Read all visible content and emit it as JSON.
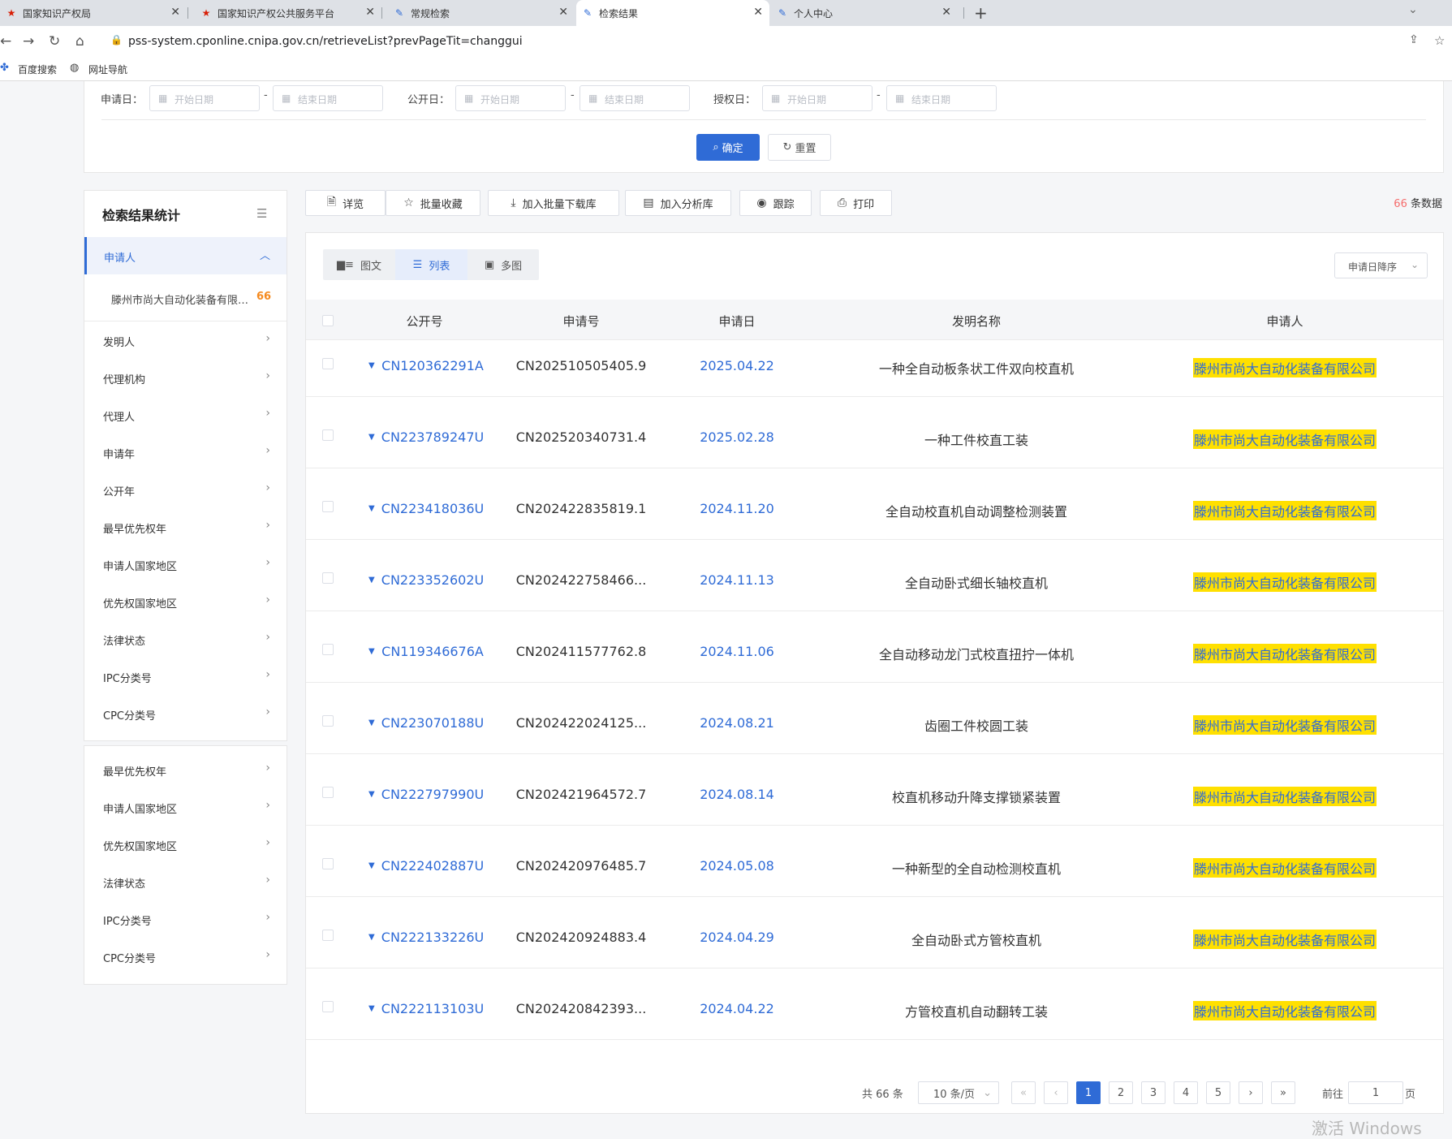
{
  "browser": {
    "tabs": [
      {
        "title": "国家知识产权局"
      },
      {
        "title": "国家知识产权公共服务平台"
      },
      {
        "title": "常规检索"
      },
      {
        "title": "检索结果"
      },
      {
        "title": "个人中心"
      }
    ],
    "url": "pss-system.cponline.cnipa.gov.cn/retrieveList?prevPageTit=changgui",
    "bookmarks": [
      "百度搜索",
      "网址导航"
    ]
  },
  "filter": {
    "apply_date_label": "申请日：",
    "public_date_label": "公开日：",
    "grant_date_label": "授权日：",
    "start_placeholder": "开始日期",
    "end_placeholder": "结束日期",
    "dash": "-",
    "ok_label": "确定",
    "reset_label": "重置"
  },
  "sidebar": {
    "title": "检索结果统计",
    "applicant_label": "申请人",
    "applicant_company": "滕州市尚大自动化装备有限公司",
    "applicant_count": "66",
    "items": [
      "发明人",
      "代理机构",
      "代理人",
      "申请年",
      "公开年",
      "最早优先权年",
      "申请人国家地区",
      "优先权国家地区",
      "法律状态",
      "IPC分类号",
      "CPC分类号"
    ],
    "items2": [
      "最早优先权年",
      "申请人国家地区",
      "优先权国家地区",
      "法律状态",
      "IPC分类号",
      "CPC分类号"
    ]
  },
  "toolbar": {
    "buttons": [
      "详览",
      "批量收藏",
      "加入批量下载库",
      "加入分析库",
      "跟踪",
      "打印"
    ],
    "count": "66",
    "count_suffix": "条数据"
  },
  "view": {
    "tabs": [
      "图文",
      "列表",
      "多图"
    ],
    "sort": "申请日降序"
  },
  "table": {
    "headers": [
      "公开号",
      "申请号",
      "申请日",
      "发明名称",
      "申请人"
    ],
    "rows": [
      {
        "pub": "CN120362291A",
        "app_no": "CN202510505405.9",
        "date": "2025.04.22",
        "title": "一种全自动板条状工件双向校直机",
        "applicant": "滕州市尚大自动化装备有限公司"
      },
      {
        "pub": "CN223789247U",
        "app_no": "CN202520340731.4",
        "date": "2025.02.28",
        "title": "一种工件校直工装",
        "applicant": "滕州市尚大自动化装备有限公司"
      },
      {
        "pub": "CN223418036U",
        "app_no": "CN202422835819.1",
        "date": "2024.11.20",
        "title": "全自动校直机自动调整检测装置",
        "applicant": "滕州市尚大自动化装备有限公司"
      },
      {
        "pub": "CN223352602U",
        "app_no": "CN202422758466...",
        "date": "2024.11.13",
        "title": "全自动卧式细长轴校直机",
        "applicant": "滕州市尚大自动化装备有限公司"
      },
      {
        "pub": "CN119346676A",
        "app_no": "CN202411577762.8",
        "date": "2024.11.06",
        "title": "全自动移动龙门式校直扭拧一体机",
        "applicant": "滕州市尚大自动化装备有限公司"
      },
      {
        "pub": "CN223070188U",
        "app_no": "CN202422024125...",
        "date": "2024.08.21",
        "title": "齿圈工件校圆工装",
        "applicant": "滕州市尚大自动化装备有限公司"
      },
      {
        "pub": "CN222797990U",
        "app_no": "CN202421964572.7",
        "date": "2024.08.14",
        "title": "校直机移动升降支撑锁紧装置",
        "applicant": "滕州市尚大自动化装备有限公司"
      },
      {
        "pub": "CN222402887U",
        "app_no": "CN202420976485.7",
        "date": "2024.05.08",
        "title": "一种新型的全自动检测校直机",
        "applicant": "滕州市尚大自动化装备有限公司"
      },
      {
        "pub": "CN222133226U",
        "app_no": "CN202420924883.4",
        "date": "2024.04.29",
        "title": "全自动卧式方管校直机",
        "applicant": "滕州市尚大自动化装备有限公司"
      },
      {
        "pub": "CN222113103U",
        "app_no": "CN202420842393...",
        "date": "2024.04.22",
        "title": "方管校直机自动翻转工装",
        "applicant": "滕州市尚大自动化装备有限公司"
      }
    ]
  },
  "pagination": {
    "total": "共 66 条",
    "page_size": "10 条/页",
    "pages": [
      "1",
      "2",
      "3",
      "4",
      "5"
    ],
    "goto_label": "前往",
    "goto_value": "1",
    "page_suffix": "页"
  },
  "watermark": "激活 Windows"
}
